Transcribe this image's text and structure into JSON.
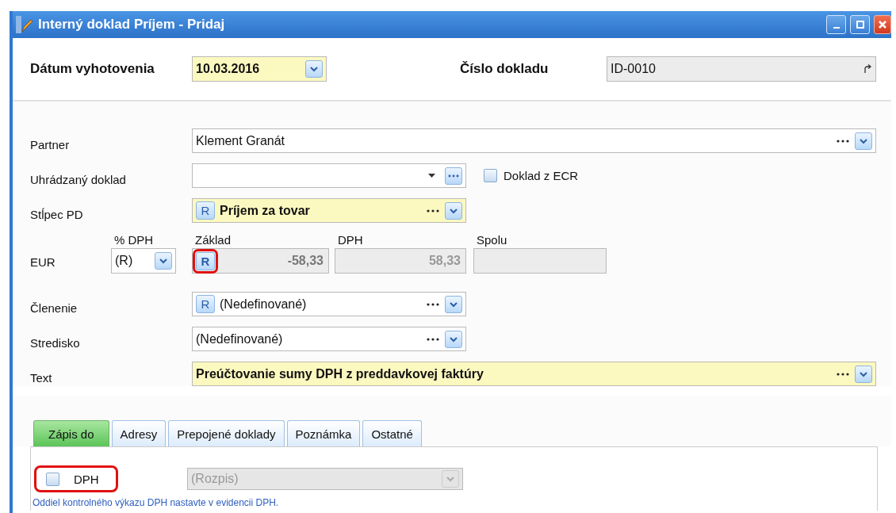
{
  "window": {
    "title": "Interný doklad Príjem - Pridaj"
  },
  "header": {
    "date": {
      "label": "Dátum vyhotovenia",
      "value": "10.03.2016",
      "required": true
    },
    "doc_number": {
      "label": "Číslo dokladu",
      "value": "ID-0010"
    }
  },
  "rows": [
    {
      "kind": "field",
      "label": "Partner",
      "field": {
        "value": "Klement  Granát",
        "wide": true,
        "required": false,
        "dots_button": false,
        "caret": false
      }
    },
    {
      "kind": "field",
      "label": "Uhrádzaný doklad",
      "field": {
        "wide": false,
        "required": false,
        "dots_button": true,
        "caret": true
      },
      "checkbox": {
        "label": "Doklad z ECR",
        "checked": false
      }
    },
    {
      "kind": "field",
      "label": "Stĺpec PD",
      "field": {
        "tag": "R",
        "value": "Príjem za tovar",
        "wide": false,
        "required": true,
        "dots_button": false,
        "caret": false
      }
    },
    {
      "kind": "amounts",
      "label": "EUR",
      "columns": [
        {
          "kind": "select",
          "heading": "% DPH",
          "value": "(R)"
        },
        {
          "kind": "amount",
          "heading": "Základ",
          "tag": "R",
          "tag_highlighted": true,
          "value": "-58,33",
          "emphasis": true
        },
        {
          "kind": "amount",
          "heading": "DPH",
          "value": "58,33",
          "emphasis": false
        },
        {
          "kind": "amount",
          "heading": "Spolu"
        }
      ]
    },
    {
      "kind": "field",
      "label": "Členenie",
      "field": {
        "tag": "R",
        "value": "(Nedefinované)",
        "wide": false,
        "required": false,
        "dots_button": false,
        "caret": false
      }
    },
    {
      "kind": "field",
      "label": "Stredisko",
      "field": {
        "value": "(Nedefinované)",
        "wide": false,
        "required": false,
        "dots_button": false,
        "caret": false
      }
    },
    {
      "kind": "field",
      "label": "Text",
      "field": {
        "value": "Preúčtovanie sumy DPH z preddavkovej faktúry",
        "wide": true,
        "required": true,
        "dots_button": false,
        "caret": false
      }
    }
  ],
  "tabs": [
    {
      "label": "Zápis do",
      "selected": true
    },
    {
      "label": "Adresy",
      "selected": false
    },
    {
      "label": "Prepojené doklady",
      "selected": false
    },
    {
      "label": "Poznámka",
      "selected": false
    },
    {
      "label": "Ostatné",
      "selected": false
    }
  ],
  "panel": {
    "checkbox": {
      "label": "DPH",
      "checked": false,
      "highlighted": true
    },
    "combo": {
      "value": "(Rozpis)",
      "disabled": true
    },
    "note": "Oddiel kontrolného výkazu DPH nastavte v evidencii DPH."
  }
}
